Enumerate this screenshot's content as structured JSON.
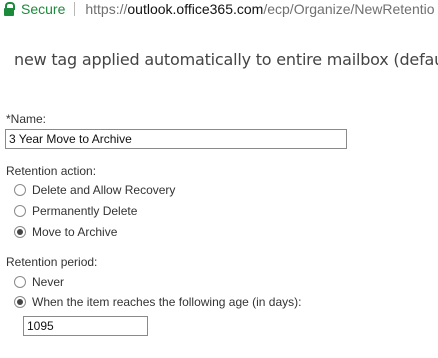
{
  "address_bar": {
    "secure_label": "Secure",
    "url_protocol": "https://",
    "url_host": "outlook.office365.com",
    "url_path": "/ecp/Organize/NewRetentio"
  },
  "dialog": {
    "title": "new tag applied automatically to entire mailbox (default)"
  },
  "form": {
    "name_label": "*Name:",
    "name_value": "3 Year Move to Archive",
    "retention_action": {
      "label": "Retention action:",
      "options": [
        {
          "label": "Delete and Allow Recovery",
          "selected": false
        },
        {
          "label": "Permanently Delete",
          "selected": false
        },
        {
          "label": "Move to Archive",
          "selected": true
        }
      ]
    },
    "retention_period": {
      "label": "Retention period:",
      "options": [
        {
          "label": "Never",
          "selected": false
        },
        {
          "label": "When the item reaches the following age (in days):",
          "selected": true
        }
      ],
      "age_value": "1095"
    }
  },
  "colors": {
    "secure_green": "#1b8a3a",
    "text": "#333333",
    "border": "#8a8a8a"
  }
}
